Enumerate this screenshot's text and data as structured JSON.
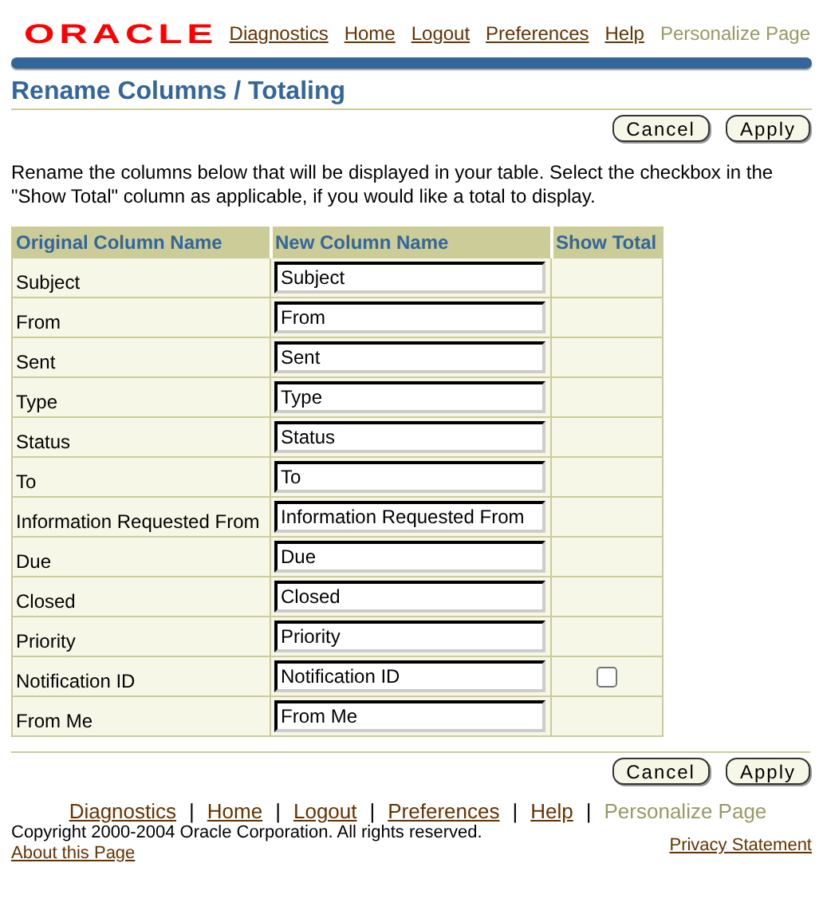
{
  "header": {
    "logo": "ORACLE",
    "links": [
      {
        "label": "Diagnostics",
        "disabled": false
      },
      {
        "label": "Home",
        "disabled": false
      },
      {
        "label": "Logout",
        "disabled": false
      },
      {
        "label": "Preferences",
        "disabled": false
      },
      {
        "label": "Help",
        "disabled": false
      },
      {
        "label": "Personalize Page",
        "disabled": true
      }
    ]
  },
  "title": "Rename Columns / Totaling",
  "top_buttons": [
    "Cancel",
    "Apply"
  ],
  "instructions": "Rename the columns below that will be displayed in your table. Select the checkbox in the \"Show Total\" column as applicable, if you would like a total to display.",
  "table": {
    "columns": [
      "Original Column Name",
      "New Column Name",
      "Show Total"
    ],
    "rows": [
      {
        "original": "Subject",
        "new_name": "Subject"
      },
      {
        "original": "From",
        "new_name": "From"
      },
      {
        "original": "Sent",
        "new_name": "Sent"
      },
      {
        "original": "Type",
        "new_name": "Type"
      },
      {
        "original": "Status",
        "new_name": "Status"
      },
      {
        "original": "To",
        "new_name": "To"
      },
      {
        "original": "Information Requested From",
        "new_name": "Information Requested From"
      },
      {
        "original": "Due",
        "new_name": "Due"
      },
      {
        "original": "Closed",
        "new_name": "Closed"
      },
      {
        "original": "Priority",
        "new_name": "Priority"
      },
      {
        "original": "Notification ID",
        "new_name": "Notification ID",
        "show_total": false
      },
      {
        "original": "From Me",
        "new_name": "From Me"
      }
    ]
  },
  "bottom_buttons": [
    "Cancel",
    "Apply"
  ],
  "footer": {
    "links": [
      {
        "label": "Diagnostics",
        "disabled": false
      },
      {
        "label": "Home",
        "disabled": false
      },
      {
        "label": "Logout",
        "disabled": false
      },
      {
        "label": "Preferences",
        "disabled": false
      },
      {
        "label": "Help",
        "disabled": false
      },
      {
        "label": "Personalize Page",
        "disabled": true
      }
    ],
    "separators": [
      "|",
      "|",
      "|",
      "|",
      "|"
    ],
    "copyright": "Copyright 2000-2004 Oracle Corporation. All rights reserved.",
    "about": "About this Page",
    "privacy": "Privacy Statement"
  }
}
